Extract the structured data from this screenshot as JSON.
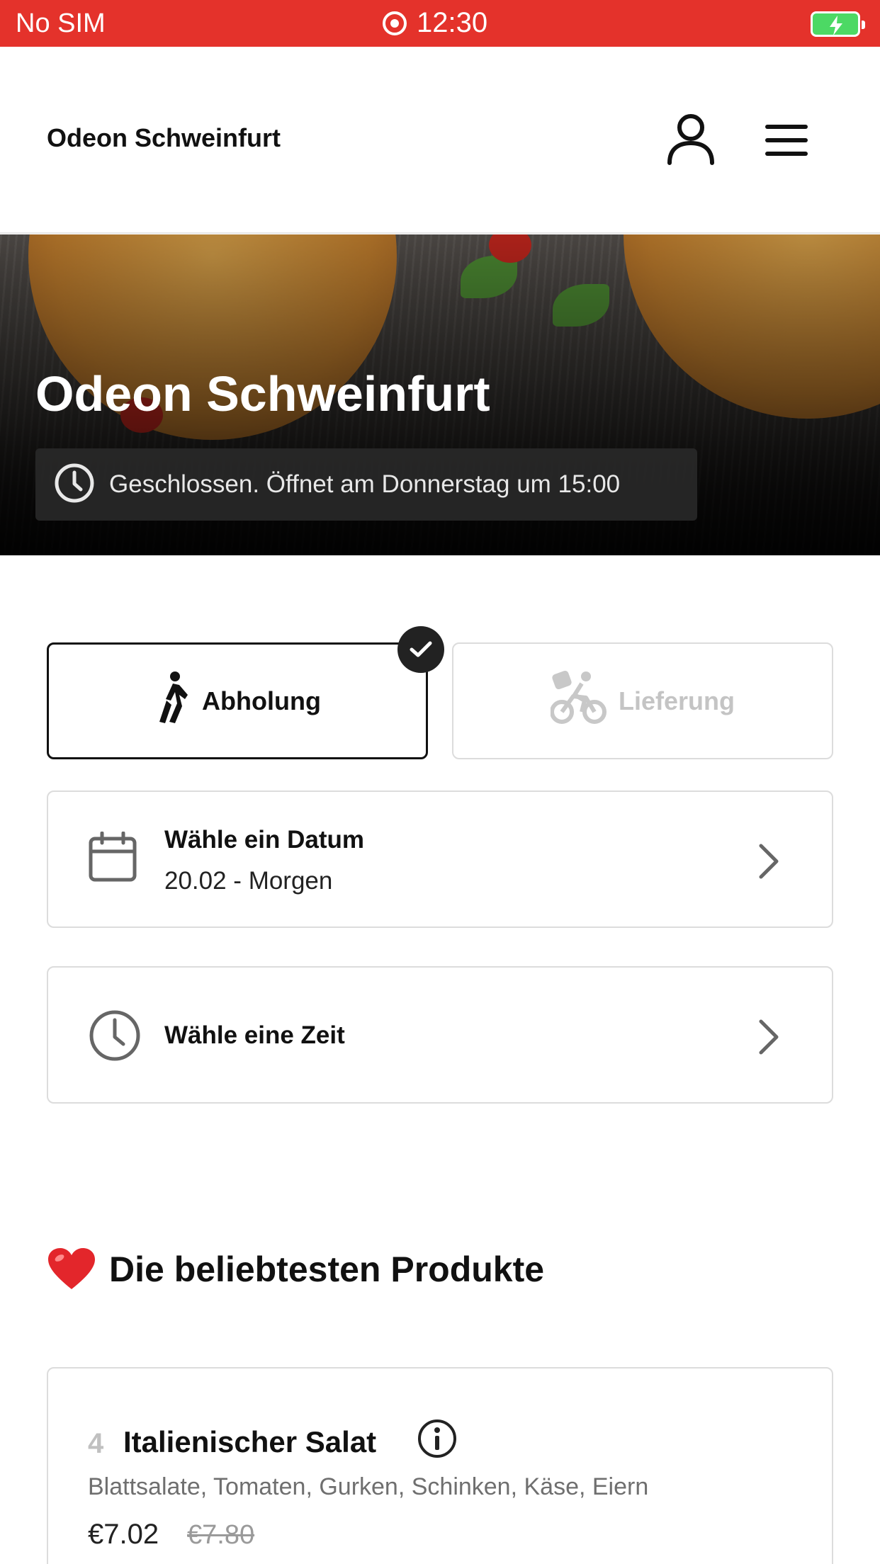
{
  "status_bar": {
    "carrier": "No SIM",
    "time": "12:30",
    "color": "#e4322b"
  },
  "header": {
    "brand": "Odeon Schweinfurt",
    "icons": [
      "user-icon",
      "menu-icon"
    ]
  },
  "hero": {
    "title": "Odeon Schweinfurt",
    "status": "Geschlossen. Öffnet am Donnerstag um 15:00"
  },
  "order_mode": {
    "pickup_label": "Abholung",
    "delivery_label": "Lieferung",
    "selected": "pickup"
  },
  "date_card": {
    "title": "Wähle ein Datum",
    "value": "20.02 - Morgen"
  },
  "time_card": {
    "title": "Wähle eine Zeit"
  },
  "popular": {
    "heading": "Die beliebtesten Produkte",
    "products": [
      {
        "number": "4",
        "name": "Italienischer Salat",
        "description": "Blattsalate, Tomaten, Gurken, Schinken, Käse, Eiern",
        "price": "€7.02",
        "old_price": "€7.80"
      }
    ]
  }
}
